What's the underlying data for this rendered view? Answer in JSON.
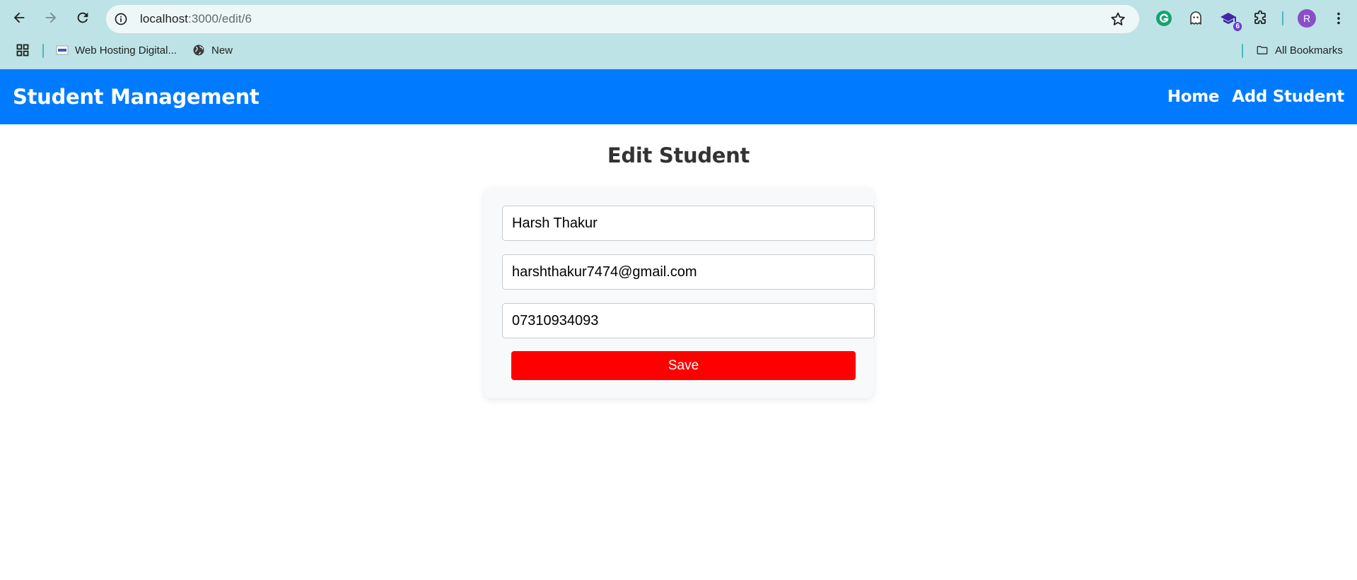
{
  "browser": {
    "url_host": "localhost",
    "url_path": ":3000/edit/6",
    "bookmarks": [
      {
        "label": "Web Hosting Digital...",
        "icon": "site-favicon-icon"
      },
      {
        "label": "New",
        "icon": "globe-icon"
      }
    ],
    "all_bookmarks_label": "All Bookmarks",
    "extension_badge": "6",
    "profile_initial": "R"
  },
  "header": {
    "brand": "Student Management",
    "links": [
      {
        "label": "Home"
      },
      {
        "label": "Add Student"
      }
    ],
    "bg_color": "#007bff"
  },
  "page": {
    "title": "Edit Student"
  },
  "form": {
    "name_value": "Harsh Thakur",
    "email_value": "harshthakur7474@gmail.com",
    "phone_value": "07310934093",
    "save_label": "Save",
    "save_color": "#ff0000"
  }
}
